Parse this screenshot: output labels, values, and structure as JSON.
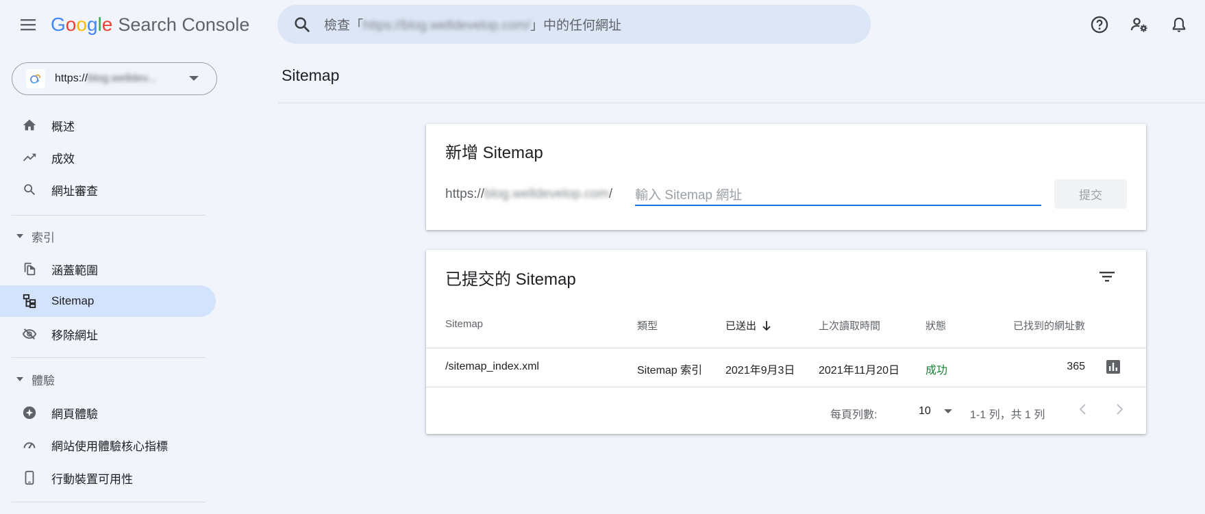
{
  "header": {
    "logo_letters": [
      "G",
      "o",
      "o",
      "g",
      "l",
      "e"
    ],
    "product_name": "Search Console",
    "search_prefix": "檢查「",
    "search_url": "https://blog.welldevelop.com/",
    "search_suffix": "」中的任何網址"
  },
  "icons": {
    "menu": "menu-icon",
    "search": "search-icon",
    "help": "help-icon",
    "users": "user-settings-icon",
    "notifications": "bell-icon"
  },
  "property": {
    "scheme": "https://",
    "domain": "blog.welldev..."
  },
  "sidebar": {
    "items_top": [
      {
        "label": "概述",
        "icon": "home-icon"
      },
      {
        "label": "成效",
        "icon": "trending-up-icon"
      },
      {
        "label": "網址審查",
        "icon": "search-icon"
      }
    ],
    "index_section": "索引",
    "index_items": [
      {
        "label": "涵蓋範圍",
        "icon": "copy-icon"
      },
      {
        "label": "Sitemap",
        "icon": "sitemap-icon"
      },
      {
        "label": "移除網址",
        "icon": "eye-off-icon"
      }
    ],
    "experience_section": "體驗",
    "experience_items": [
      {
        "label": "網頁體驗",
        "icon": "add-circle-icon"
      },
      {
        "label": "網站使用體驗核心指標",
        "icon": "speedometer-icon"
      },
      {
        "label": "行動裝置可用性",
        "icon": "phone-icon"
      }
    ],
    "active_item": "Sitemap"
  },
  "main": {
    "page_title": "Sitemap",
    "add_card": {
      "title": "新增 Sitemap",
      "prefix_scheme": "https://",
      "prefix_domain": "blog.welldevelop.com",
      "prefix_slash": "/",
      "input_placeholder": "輸入 Sitemap 網址",
      "input_value": "",
      "submit_label": "提交"
    },
    "submitted_card": {
      "title": "已提交的 Sitemap",
      "columns": [
        "Sitemap",
        "類型",
        "已送出",
        "上次讀取時間",
        "狀態",
        "已找到的網址數"
      ],
      "rows": [
        {
          "sitemap": "/sitemap_index.xml",
          "type": "Sitemap 索引",
          "submitted": "2021年9月3日",
          "last_read": "2021年11月20日",
          "status": "成功",
          "urls_found": "365"
        }
      ],
      "pagination": {
        "rows_per_page_label": "每頁列數:",
        "rows_per_page_value": "10",
        "range_text": "1-1 列，共 1 列"
      }
    }
  },
  "colors": {
    "accent": "#1a73e8",
    "active_nav": "#d3e3fd",
    "success": "#188038",
    "background": "#f1f4fb"
  }
}
